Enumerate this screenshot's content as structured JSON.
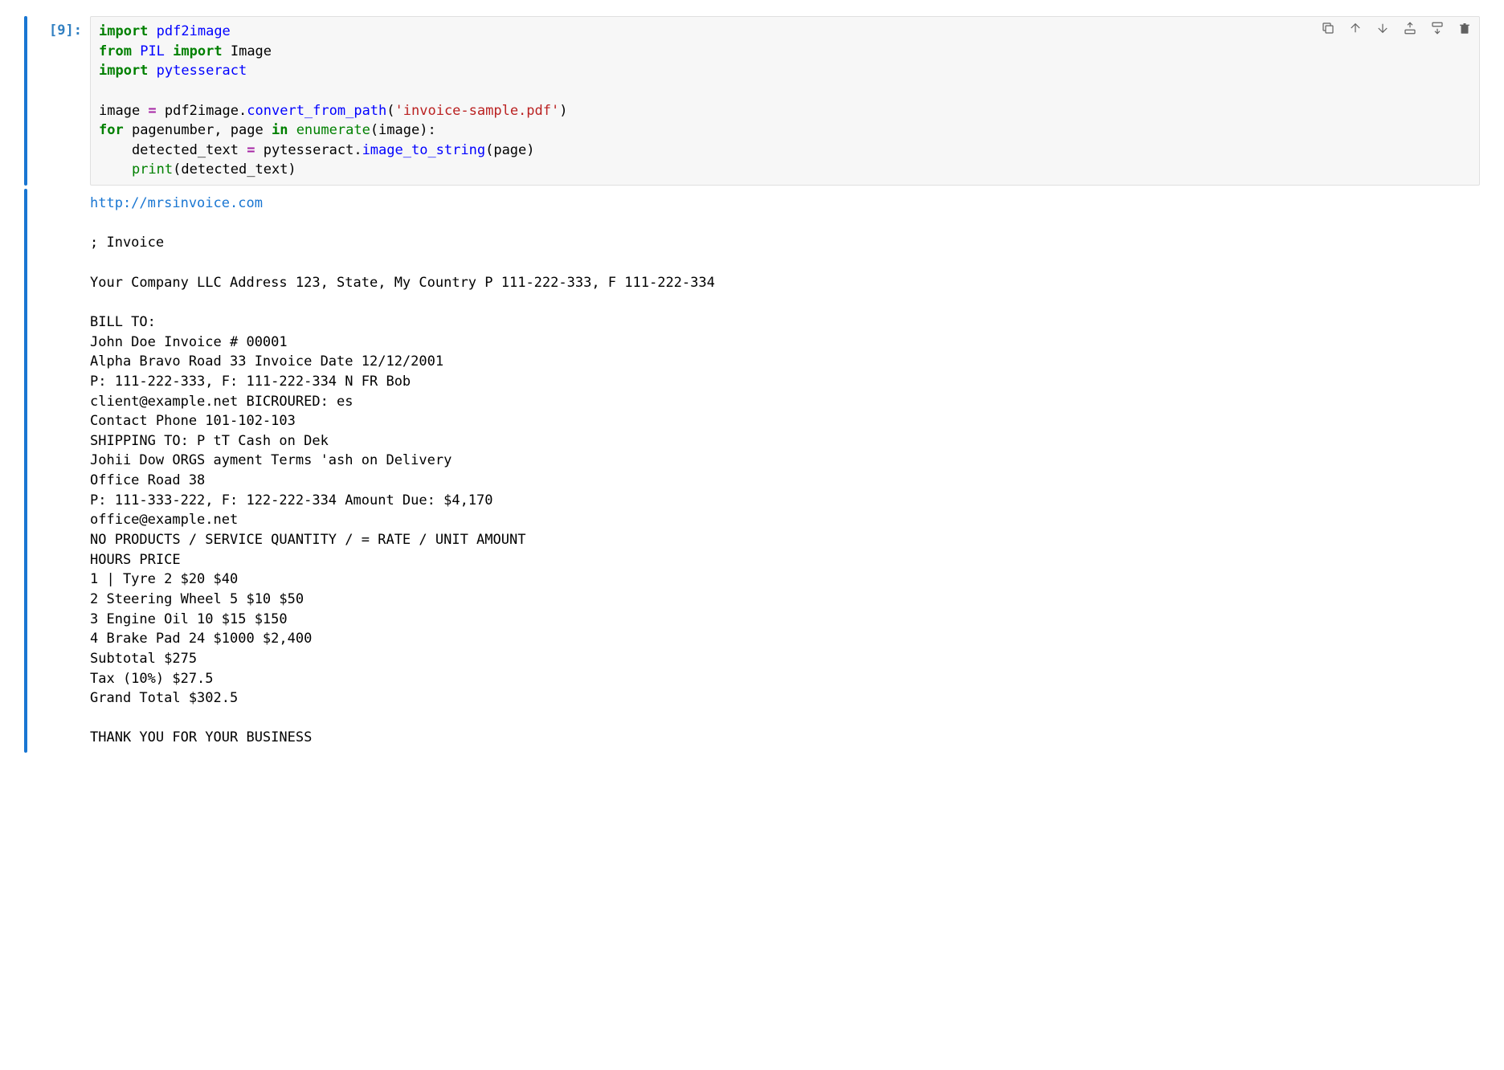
{
  "cell": {
    "prompt": "[9]:",
    "code": {
      "l1_kw1": "import",
      "l1_mod": "pdf2image",
      "l2_kw1": "from",
      "l2_mod": "PIL",
      "l2_kw2": "import",
      "l2_name": "Image",
      "l3_kw1": "import",
      "l3_mod": "pytesseract",
      "l5_var": "image ",
      "l5_eq": "=",
      "l5_sp": " pdf2image",
      "l5_dot": ".",
      "l5_fn": "convert_from_path",
      "l5_op": "(",
      "l5_str": "'invoice-sample.pdf'",
      "l5_cp": ")",
      "l6_kw": "for",
      "l6_rest1": " pagenumber, page ",
      "l6_kw2": "in",
      "l6_sp2": " ",
      "l6_fn": "enumerate",
      "l6_op": "(image):",
      "l7_pre": "    detected_text ",
      "l7_eq": "=",
      "l7_sp": " pytesseract",
      "l7_dot": ".",
      "l7_fn": "image_to_string",
      "l7_op": "(page)",
      "l8_pre": "    ",
      "l8_fn": "print",
      "l8_op": "(detected_text)"
    },
    "toolbar": {
      "duplicate": "duplicate",
      "up": "move up",
      "down": "move down",
      "insert_above": "insert above",
      "insert_below": "insert below",
      "delete": "delete"
    },
    "output": {
      "link": "http://mrsinvoice.com",
      "body": "\n\n; Invoice\n\nYour Company LLC Address 123, State, My Country P 111-222-333, F 111-222-334\n\nBILL TO:\nJohn Doe Invoice # 00001\nAlpha Bravo Road 33 Invoice Date 12/12/2001\nP: 111-222-333, F: 111-222-334 N FR Bob\nclient@example.net BICROURED: es\nContact Phone 101-102-103\nSHIPPING TO: P tT Cash on Dek\nJohii Dow ORGS ayment Terms 'ash on Delivery\nOffice Road 38\nP: 111-333-222, F: 122-222-334 Amount Due: $4,170\noffice@example.net\nNO PRODUCTS / SERVICE QUANTITY / = RATE / UNIT AMOUNT\nHOURS PRICE\n1 | Tyre 2 $20 $40\n2 Steering Wheel 5 $10 $50\n3 Engine Oil 10 $15 $150\n4 Brake Pad 24 $1000 $2,400\nSubtotal $275\nTax (10%) $27.5\nGrand Total $302.5\n\nTHANK YOU FOR YOUR BUSINESS"
    }
  }
}
